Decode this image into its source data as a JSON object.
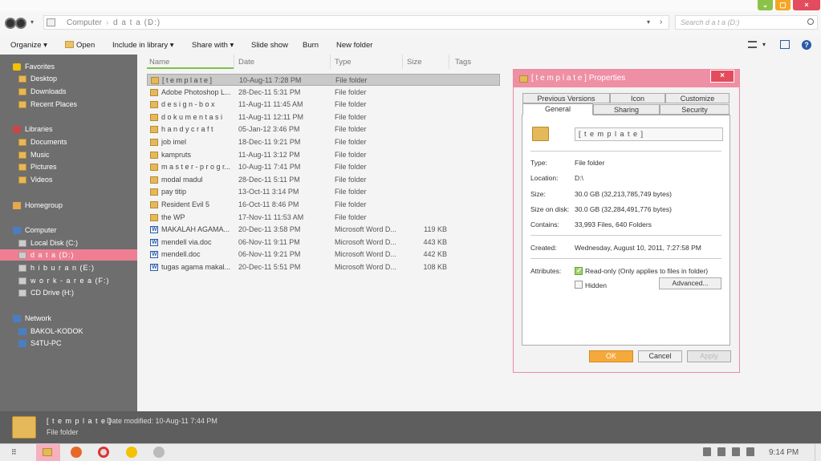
{
  "window_controls": {
    "minimize": "⌄",
    "maximize": "▢",
    "close": "×"
  },
  "nav": {
    "dropdown": "▾"
  },
  "address": {
    "crumbs": [
      "Computer",
      "d a t a (D:)"
    ],
    "separator": "›",
    "dropdown": "▾",
    "refresh": "›"
  },
  "search": {
    "placeholder": "Search d a t a (D:)"
  },
  "toolbar": {
    "organize": "Organize ▾",
    "open": "Open",
    "include_in_library": "Include in library ▾",
    "share_with": "Share with ▾",
    "slide_show": "Slide show",
    "burn": "Burn",
    "new_folder": "New folder",
    "view_drop": "▾",
    "help": "?"
  },
  "sidebar": {
    "favorites": "Favorites",
    "favorites_items": [
      "Desktop",
      "Downloads",
      "Recent Places"
    ],
    "libraries": "Libraries",
    "libraries_items": [
      "Documents",
      "Music",
      "Pictures",
      "Videos"
    ],
    "homegroup": "Homegroup",
    "computer": "Computer",
    "computer_items": [
      "Local Disk (C:)",
      "d a t a (D:)",
      "h i b u r a n (E:)",
      "w o r k - a r e a (F:)",
      "CD Drive (H:)"
    ],
    "network": "Network",
    "network_items": [
      "BAKOL-KODOK",
      "S4TU-PC"
    ]
  },
  "columns": {
    "name": "Name",
    "date": "Date",
    "type": "Type",
    "size": "Size",
    "tags": "Tags"
  },
  "files": [
    {
      "name": "[ t e m p l a t e ]",
      "date": "10-Aug-11 7:28 PM",
      "type": "File folder",
      "size": "",
      "kind": "folder"
    },
    {
      "name": "Adobe Photoshop L...",
      "date": "28-Dec-11 5:31 PM",
      "type": "File folder",
      "size": "",
      "kind": "folder"
    },
    {
      "name": "d e s i g n  -  b o x",
      "date": "11-Aug-11 11:45 AM",
      "type": "File folder",
      "size": "",
      "kind": "folder"
    },
    {
      "name": "d o k u m e n t a s i",
      "date": "11-Aug-11 12:11 PM",
      "type": "File folder",
      "size": "",
      "kind": "folder"
    },
    {
      "name": "h a n d y c r a f t",
      "date": "05-Jan-12 3:46 PM",
      "type": "File folder",
      "size": "",
      "kind": "folder"
    },
    {
      "name": "job imel",
      "date": "18-Dec-11 9:21 PM",
      "type": "File folder",
      "size": "",
      "kind": "folder"
    },
    {
      "name": "kampruts",
      "date": "11-Aug-11 3:12 PM",
      "type": "File folder",
      "size": "",
      "kind": "folder"
    },
    {
      "name": "m a s t e r - p r o g r...",
      "date": "10-Aug-11 7:41 PM",
      "type": "File folder",
      "size": "",
      "kind": "folder"
    },
    {
      "name": "modal madul",
      "date": "28-Dec-11 5:11 PM",
      "type": "File folder",
      "size": "",
      "kind": "folder"
    },
    {
      "name": "pay titip",
      "date": "13-Oct-11 3:14 PM",
      "type": "File folder",
      "size": "",
      "kind": "folder"
    },
    {
      "name": "Resident Evil 5",
      "date": "16-Oct-11 8:46 PM",
      "type": "File folder",
      "size": "",
      "kind": "folder"
    },
    {
      "name": "the WP",
      "date": "17-Nov-11 11:53 AM",
      "type": "File folder",
      "size": "",
      "kind": "folder"
    },
    {
      "name": "MAKALAH AGAMA...",
      "date": "20-Dec-11 3:58 PM",
      "type": "Microsoft Word D...",
      "size": "119 KB",
      "kind": "doc"
    },
    {
      "name": "mendell via.doc",
      "date": "06-Nov-11 9:11 PM",
      "type": "Microsoft Word D...",
      "size": "443 KB",
      "kind": "doc"
    },
    {
      "name": "mendell.doc",
      "date": "06-Nov-11 9:21 PM",
      "type": "Microsoft Word D...",
      "size": "442 KB",
      "kind": "doc"
    },
    {
      "name": "tugas agama makal...",
      "date": "20-Dec-11 5:51 PM",
      "type": "Microsoft Word D...",
      "size": "108 KB",
      "kind": "doc"
    }
  ],
  "dialog": {
    "title": "[ t e m p l a t e ] Properties",
    "close": "×",
    "tabs_top": [
      "Previous Versions",
      "Icon",
      "Customize"
    ],
    "tabs_bottom": [
      "General",
      "Sharing",
      "Security"
    ],
    "folder_name": "[ t e m p l a t e ]",
    "type_label": "Type:",
    "type_value": "File folder",
    "location_label": "Location:",
    "location_value": "D:\\",
    "size_label": "Size:",
    "size_value": "30.0 GB (32,213,785,749 bytes)",
    "size_on_disk_label": "Size on disk:",
    "size_on_disk_value": "30.0 GB (32,284,491,776 bytes)",
    "contains_label": "Contains:",
    "contains_value": "33,993 Files, 640 Folders",
    "created_label": "Created:",
    "created_value": "Wednesday, August 10, 2011, 7:27:58 PM",
    "attributes_label": "Attributes:",
    "readonly_label": "Read-only (Only applies to files in folder)",
    "hidden_label": "Hidden",
    "advanced": "Advanced...",
    "ok": "OK",
    "cancel": "Cancel",
    "apply": "Apply"
  },
  "details": {
    "name": "[ t e m p l a t e ]",
    "modified": "Date modified: 10-Aug-11 7:44 PM",
    "type": "File folder"
  },
  "taskbar": {
    "start": "⠿",
    "clock": "9:14 PM"
  }
}
